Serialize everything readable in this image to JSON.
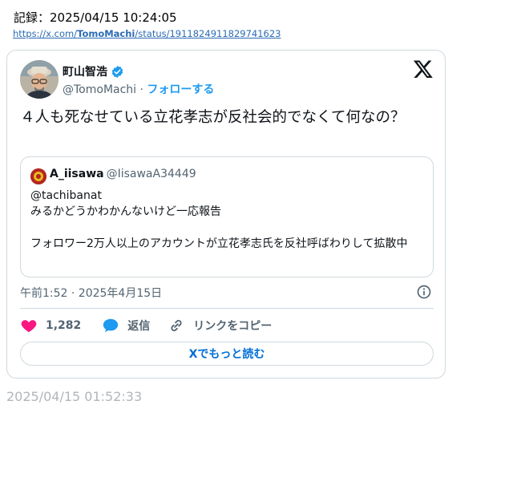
{
  "record": {
    "label": "記録：2025/04/15 10:24:05",
    "url_prefix": "https://x.com/",
    "url_user": "TomoMachi",
    "url_suffix": "/status/1911824911829741623"
  },
  "tweet": {
    "author_name": "町山智浩",
    "author_handle": "@TomoMachi",
    "separator": " · ",
    "follow_label": "フォローする",
    "text": "４人も死なせている立花孝志が反社会的でなくて何なの？",
    "quote": {
      "author_name": "A_iisawa",
      "author_handle": "@IisawaA34449",
      "text": "@tachibanat\nみるかどうかわかんないけど一応報告\n\nフォロワー2万人以上のアカウントが立花孝志氏を反社呼ばわりして拡散中"
    },
    "timestamp": "午前1:52 · 2025年4月15日",
    "like_count": "1,282",
    "reply_label": "返信",
    "copy_link_label": "リンクをコピー",
    "read_more_label": "Xでもっと読む"
  },
  "footer_date": "2025/04/15 01:52:33",
  "colors": {
    "accent": "#1d9bf0",
    "like": "#f91880",
    "link_button": "#006fd6",
    "muted": "#536471",
    "border": "#cfd9de"
  },
  "icons": [
    "verified-badge-icon",
    "x-logo-icon",
    "info-icon",
    "heart-icon",
    "reply-bubble-icon",
    "link-icon"
  ]
}
